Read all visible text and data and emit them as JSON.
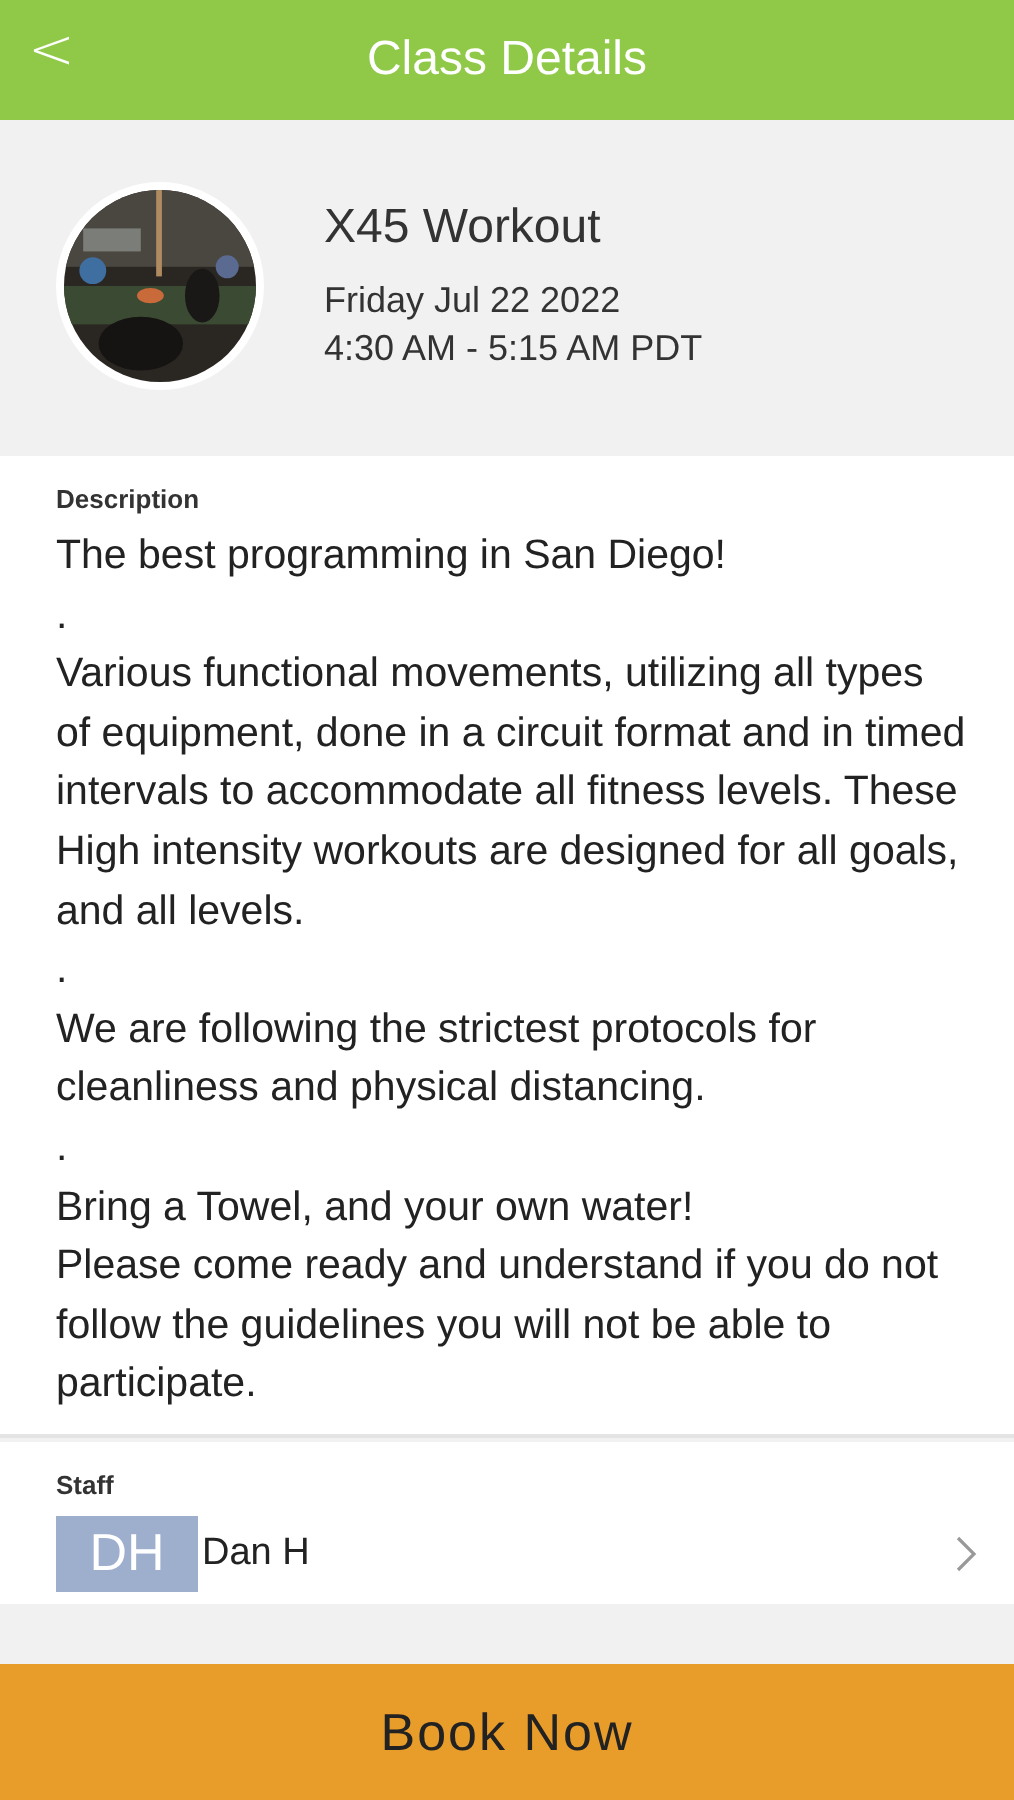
{
  "header": {
    "title": "Class Details",
    "back": "<"
  },
  "class": {
    "name": "X45 Workout",
    "date": "Friday Jul 22 2022",
    "time": "4:30 AM - 5:15 AM PDT"
  },
  "description": {
    "label": "Description",
    "paragraphs": [
      "The best programming in San Diego!",
      ".",
      "Various functional movements, utilizing all types of equipment, done in a circuit format and in timed intervals to accommodate all fitness levels. These High intensity workouts are designed for all goals, and all levels.",
      ".",
      "We are following the strictest protocols for cleanliness and physical distancing.",
      ".",
      "Bring a Towel, and your own water!",
      "Please come ready and understand if you do not follow the guidelines you will not be able to participate."
    ]
  },
  "staff": {
    "label": "Staff",
    "members": [
      {
        "initials": "DH",
        "name": "Dan H",
        "color": "#9eaecd"
      }
    ]
  },
  "book_button": "Book Now"
}
